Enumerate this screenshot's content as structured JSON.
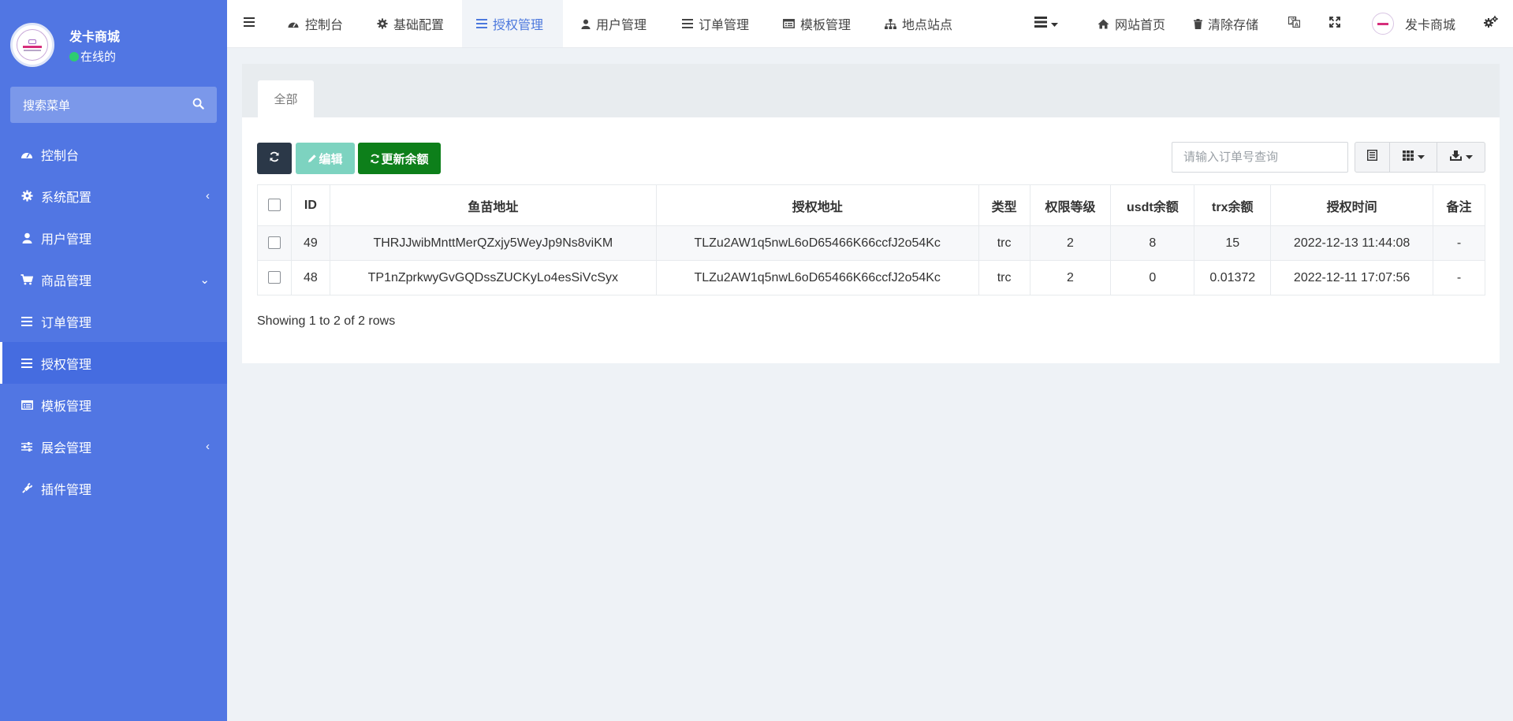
{
  "sidebar": {
    "site_name": "发卡商城",
    "status": "在线的",
    "search_placeholder": "搜索菜单",
    "items": [
      {
        "label": "控制台"
      },
      {
        "label": "系统配置"
      },
      {
        "label": "用户管理"
      },
      {
        "label": "商品管理"
      },
      {
        "label": "订单管理"
      },
      {
        "label": "授权管理"
      },
      {
        "label": "模板管理"
      },
      {
        "label": "展会管理"
      },
      {
        "label": "插件管理"
      }
    ]
  },
  "navbar": {
    "tabs": [
      {
        "label": "控制台"
      },
      {
        "label": "基础配置"
      },
      {
        "label": "授权管理"
      },
      {
        "label": "用户管理"
      },
      {
        "label": "订单管理"
      },
      {
        "label": "模板管理"
      },
      {
        "label": "地点站点"
      }
    ],
    "home_label": "网站首页",
    "clear_label": "清除存储",
    "user_name": "发卡商城"
  },
  "panel": {
    "tab_all": "全部"
  },
  "toolbar": {
    "edit_label": "编辑",
    "update_label": "更新余额",
    "search_placeholder": "请输入订单号查询"
  },
  "table": {
    "columns": [
      "ID",
      "鱼苗地址",
      "授权地址",
      "类型",
      "权限等级",
      "usdt余额",
      "trx余额",
      "授权时间",
      "备注"
    ],
    "rows": [
      [
        "49",
        "THRJJwibMnttMerQZxjy5WeyJp9Ns8viKM",
        "TLZu2AW1q5nwL6oD65466K66ccfJ2o54Kc",
        "trc",
        "2",
        "8",
        "15",
        "2022-12-13 11:44:08",
        "-"
      ],
      [
        "48",
        "TP1nZprkwyGvGQDssZUCKyLo4esSiVcSyx",
        "TLZu2AW1q5nwL6oD65466K66ccfJ2o54Kc",
        "trc",
        "2",
        "0",
        "0.01372",
        "2022-12-11 17:07:56",
        "-"
      ]
    ]
  },
  "footer": {
    "rows_info": "Showing 1 to 2 of 2 rows"
  },
  "colors": {
    "sidebar": "#5176e3",
    "active_nav": "#4c78dd",
    "update_button": "#0d7f1a",
    "edit_button": "#7dd3c0",
    "refresh_button": "#2b3848"
  }
}
